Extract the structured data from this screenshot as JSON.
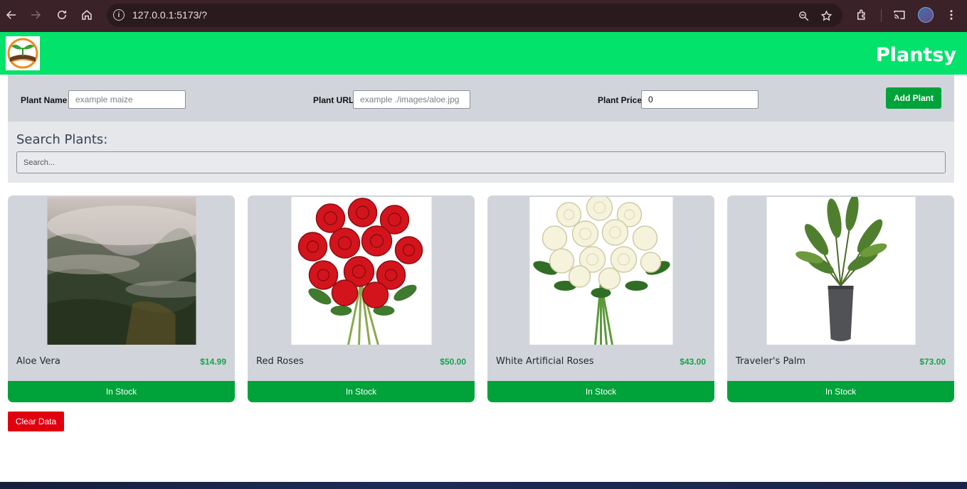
{
  "browser": {
    "url": "127.0.0.1:5173/?",
    "info_glyph": "i",
    "icons": [
      "back-icon",
      "forward-icon",
      "reload-icon",
      "home-icon",
      "zoom-icon",
      "star-icon",
      "extensions-icon",
      "cast-icon",
      "profile-avatar",
      "menu-icon"
    ]
  },
  "header": {
    "brand": "Plantsy",
    "color": "#03e26b"
  },
  "form": {
    "name_label": "Plant Name",
    "name_placeholder": "example maize",
    "url_label": "Plant URL",
    "url_placeholder": "example ./images/aloe.jpg",
    "price_label": "Plant Price",
    "price_value": "0",
    "add_label": "Add Plant"
  },
  "search": {
    "title": "Search Plants:",
    "placeholder": "Search..."
  },
  "plants": [
    {
      "name": "Aloe Vera",
      "price": "$14.99",
      "status": "In Stock",
      "image": "misty-forest"
    },
    {
      "name": "Red Roses",
      "price": "$50.00",
      "status": "In Stock",
      "image": "red-roses"
    },
    {
      "name": "White Artificial Roses",
      "price": "$43.00",
      "status": "In Stock",
      "image": "white-roses"
    },
    {
      "name": "Traveler's Palm",
      "price": "$73.00",
      "status": "In Stock",
      "image": "potted-palm"
    }
  ],
  "clear_label": "Clear Data",
  "colors": {
    "accent": "#00a33a",
    "danger": "#e1000f",
    "price": "#16a34a"
  }
}
